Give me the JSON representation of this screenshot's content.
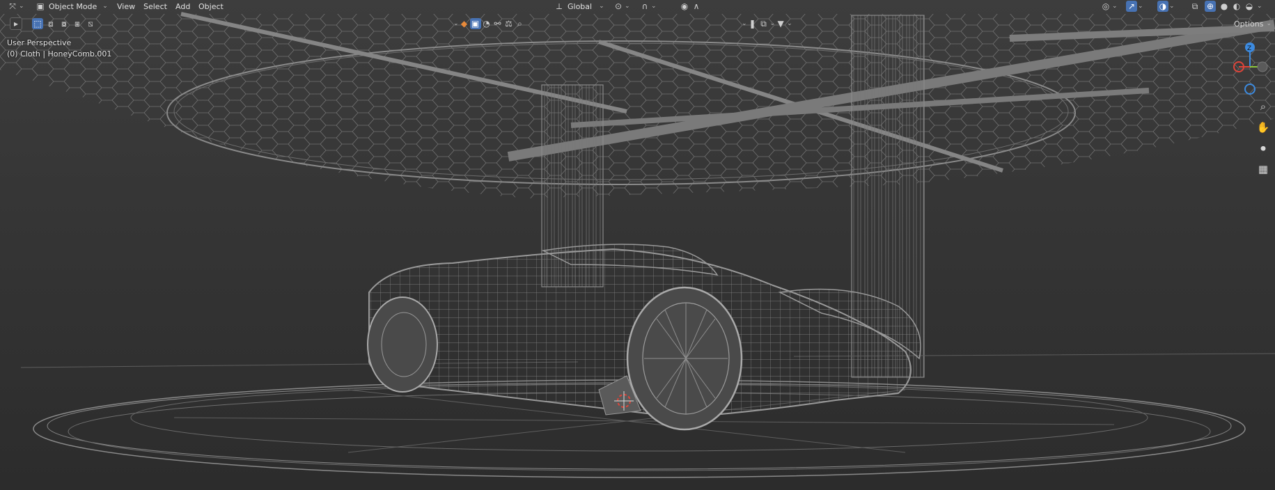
{
  "header": {
    "mode_label": "Object Mode",
    "menus": [
      "View",
      "Select",
      "Add",
      "Object"
    ],
    "transform_orientation": "Global",
    "options_label": "Options"
  },
  "viewport": {
    "view_name": "User Perspective",
    "object_info": "(0) Cloth | HoneyComb.001"
  },
  "gizmo": {
    "z_label": "Z"
  },
  "colors": {
    "accent": "#4772b3",
    "x_axis": "#e0453a",
    "y_axis": "#8cc63a",
    "z_axis": "#3d8be0",
    "wire": "#8a8a8a"
  },
  "icons": {
    "editor_type": "transform-gizmo-icon",
    "mode": "object-mode-icon",
    "select_tool": "select-cursor-icon",
    "navigation": [
      "zoom-icon",
      "pan-hand-icon",
      "camera-icon",
      "grid-view-icon"
    ]
  }
}
